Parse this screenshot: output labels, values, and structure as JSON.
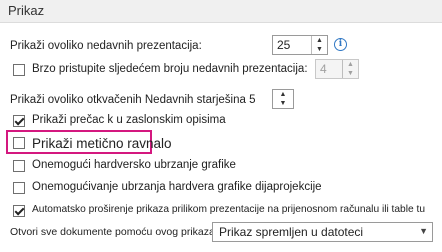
{
  "section_title": "Prikaz",
  "recent_presentations": {
    "label": "Prikaži ovoliko nedavnih prezentacija:",
    "value": "25"
  },
  "quick_access": {
    "label": "Brzo pristupite sljedećem broju nedavnih prezentacija:",
    "value": "4",
    "checked": false
  },
  "unpinned_folders": {
    "label": "Prikaži ovoliko otkvačenih Nedavnih starješina 5",
    "value": "5"
  },
  "screentips": {
    "label": "Prikaži prečac k u zaslonskim opisima",
    "checked": true
  },
  "vertical_ruler": {
    "label": "Prikaži metično ravnalo",
    "checked": false
  },
  "disable_hw_accel": {
    "label": "Onemogući hardversko ubrzanje grafike",
    "checked": false
  },
  "disable_slideshow_accel": {
    "label": "Onemogućivanje ubrzanja hardvera grafike dijaprojekcije",
    "checked": false
  },
  "auto_extend": {
    "label": "Automatsko proširenje prikaza prilikom prezentacije na prijenosnom računalu ili table tu",
    "checked": true
  },
  "open_documents": {
    "label": "Otvori sve dokumente pomoću ovog prikaza",
    "selected": "Prikaz spremljen u datoteci"
  },
  "icons": {
    "info": "info-icon",
    "up": "spin-up-icon",
    "down": "spin-down-icon",
    "dropdown": "chevron-down-icon"
  }
}
